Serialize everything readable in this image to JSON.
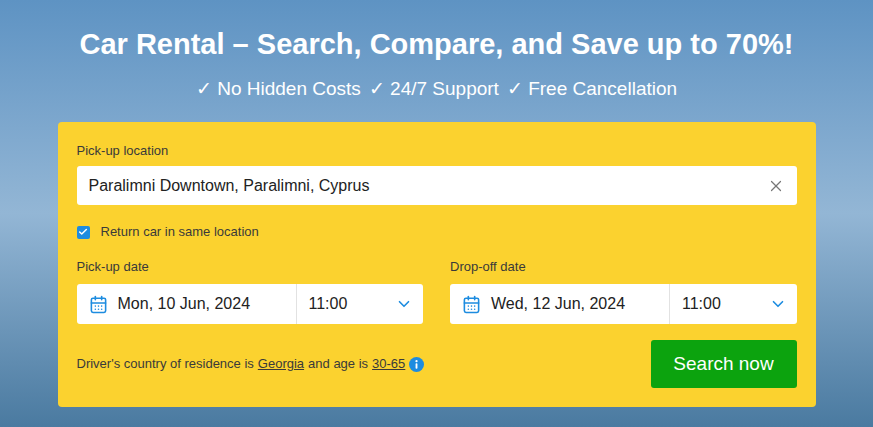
{
  "hero": {
    "title": "Car Rental – Search, Compare, and Save up to 70%!",
    "features": [
      "✓ No Hidden Costs",
      "✓ 24/7 Support",
      "✓ Free Cancellation"
    ]
  },
  "form": {
    "pickup_location": {
      "label": "Pick-up location",
      "value": "Paralimni Downtown, Paralimni, Cyprus"
    },
    "same_location": {
      "label": "Return car in same location",
      "checked": true
    },
    "dates": [
      {
        "label": "Pick-up date",
        "date": "Mon, 10 Jun, 2024",
        "time": "11:00"
      },
      {
        "label": "Drop-off date",
        "date": "Wed, 12 Jun, 2024",
        "time": "11:00"
      }
    ],
    "driver": {
      "prefix": "Driver's country of residence is",
      "country": "Georgia",
      "middle": "and age is",
      "age": "30-65"
    },
    "search_button": "Search now"
  }
}
